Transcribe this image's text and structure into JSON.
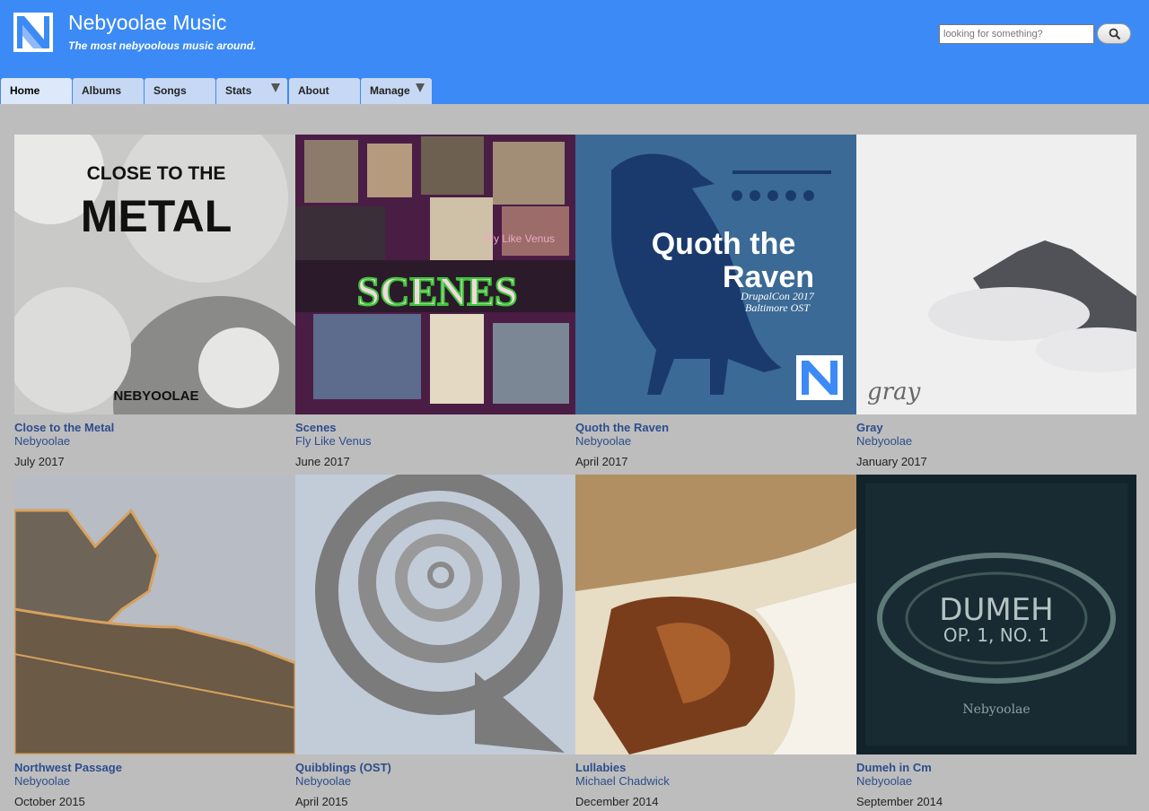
{
  "site": {
    "name": "Nebyoolae Music",
    "slogan": "The most nebyoolous music around."
  },
  "search": {
    "placeholder": "looking for something?"
  },
  "nav": {
    "tabs": [
      {
        "label": "Home",
        "active": true
      },
      {
        "label": "Albums"
      },
      {
        "label": "Songs"
      },
      {
        "label": "Stats",
        "dropdown": true
      },
      {
        "label": "About"
      },
      {
        "label": "Manage",
        "dropdown": true
      }
    ]
  },
  "albums": [
    {
      "title": "Close to the Metal",
      "artist": "Nebyoolae",
      "date": "July 2017",
      "cover_text": [
        "CLOSE TO THE",
        "METAL",
        "NEBYOOLAE"
      ]
    },
    {
      "title": "Scenes",
      "artist": "Fly Like Venus",
      "date": "June 2017",
      "cover_text": [
        "SCENES",
        "Fly Like Venus"
      ]
    },
    {
      "title": "Quoth the Raven",
      "artist": "Nebyoolae",
      "date": "April 2017",
      "cover_text": [
        "Quoth the",
        "Raven",
        "DrupalCon 2017",
        "Baltimore OST"
      ]
    },
    {
      "title": "Gray",
      "artist": "Nebyoolae",
      "date": "January 2017",
      "cover_text": [
        "gray"
      ]
    },
    {
      "title": "Northwest Passage",
      "artist": "Nebyoolae",
      "date": "October 2015"
    },
    {
      "title": "Quibblings (OST)",
      "artist": "Nebyoolae",
      "date": "April 2015"
    },
    {
      "title": "Lullabies",
      "artist": "Michael Chadwick",
      "date": "December 2014"
    },
    {
      "title": "Dumeh in Cm",
      "artist": "Nebyoolae",
      "date": "September 2014",
      "cover_text": [
        "DUMEH",
        "OP. 1, NO. 1",
        "Nebyoolae"
      ]
    }
  ]
}
